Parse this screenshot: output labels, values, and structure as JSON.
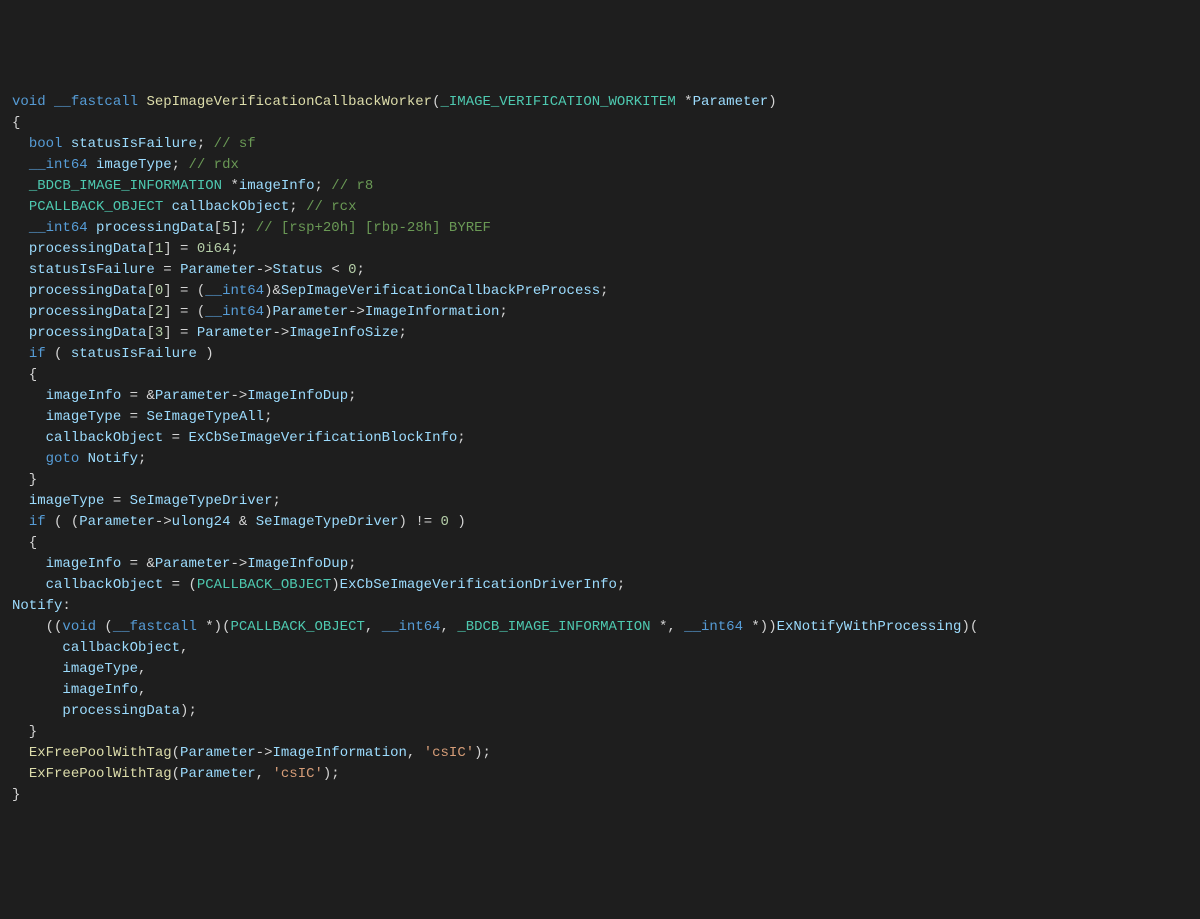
{
  "code": {
    "l01": {
      "t1": "void",
      "t2": "__fastcall",
      "fn": "SepImageVerificationCallbackWorker",
      "op1": "(",
      "type": "_IMAGE_VERIFICATION_WORKITEM",
      "op2": " *",
      "param": "Parameter",
      "op3": ")"
    },
    "l02": "{",
    "l03": {
      "pad": "  ",
      "t1": "bool",
      "v": "statusIsFailure",
      "op": "; ",
      "c": "// sf"
    },
    "l04": {
      "pad": "  ",
      "t1": "__int64",
      "v": "imageType",
      "op": "; ",
      "c": "// rdx"
    },
    "l05": {
      "pad": "  ",
      "t1": "_BDCB_IMAGE_INFORMATION",
      "op1": " *",
      "v": "imageInfo",
      "op2": "; ",
      "c": "// r8"
    },
    "l06": {
      "pad": "  ",
      "t1": "PCALLBACK_OBJECT",
      "v": "callbackObject",
      "op": "; ",
      "c": "// rcx"
    },
    "l07": {
      "pad": "  ",
      "t1": "__int64",
      "v": "processingData",
      "op1": "[",
      "n": "5",
      "op2": "]; ",
      "c": "// [rsp+20h] [rbp-28h] BYREF"
    },
    "l08": "",
    "l09": {
      "pad": "  ",
      "v": "processingData",
      "op1": "[",
      "n1": "1",
      "op2": "] = ",
      "n2": "0i64",
      "op3": ";"
    },
    "l10": {
      "pad": "  ",
      "v1": "statusIsFailure",
      "op1": " = ",
      "v2": "Parameter",
      "op2": "->",
      "m": "Status",
      "op3": " < ",
      "n": "0",
      "op4": ";"
    },
    "l11": {
      "pad": "  ",
      "v": "processingData",
      "op1": "[",
      "n": "0",
      "op2": "] = (",
      "t": "__int64",
      "op3": ")&",
      "g": "SepImageVerificationCallbackPreProcess",
      "op4": ";"
    },
    "l12": {
      "pad": "  ",
      "v": "processingData",
      "op1": "[",
      "n": "2",
      "op2": "] = (",
      "t": "__int64",
      "op3": ")",
      "p": "Parameter",
      "op4": "->",
      "m": "ImageInformation",
      "op5": ";"
    },
    "l13": {
      "pad": "  ",
      "v": "processingData",
      "op1": "[",
      "n": "3",
      "op2": "] = ",
      "p": "Parameter",
      "op3": "->",
      "m": "ImageInfoSize",
      "op4": ";"
    },
    "l14": {
      "pad": "  ",
      "kw": "if",
      "op1": " ( ",
      "v": "statusIsFailure",
      "op2": " )"
    },
    "l15": "  {",
    "l16": {
      "pad": "    ",
      "v": "imageInfo",
      "op1": " = &",
      "p": "Parameter",
      "op2": "->",
      "m": "ImageInfoDup",
      "op3": ";"
    },
    "l17": {
      "pad": "    ",
      "v": "imageType",
      "op1": " = ",
      "g": "SeImageTypeAll",
      "op2": ";"
    },
    "l18": {
      "pad": "    ",
      "v": "callbackObject",
      "op1": " = ",
      "g": "ExCbSeImageVerificationBlockInfo",
      "op2": ";"
    },
    "l19": {
      "pad": "    ",
      "kw": "goto",
      "sp": " ",
      "lbl": "Notify",
      "op": ";"
    },
    "l20": "  }",
    "l21": {
      "pad": "  ",
      "v": "imageType",
      "op1": " = ",
      "g": "SeImageTypeDriver",
      "op2": ";"
    },
    "l22": {
      "pad": "  ",
      "kw": "if",
      "op1": " ( (",
      "p": "Parameter",
      "op2": "->",
      "m": "ulong24",
      "op3": " & ",
      "g": "SeImageTypeDriver",
      "op4": ") != ",
      "n": "0",
      "op5": " )"
    },
    "l23": "  {",
    "l24": {
      "pad": "    ",
      "v": "imageInfo",
      "op1": " = &",
      "p": "Parameter",
      "op2": "->",
      "m": "ImageInfoDup",
      "op3": ";"
    },
    "l25": {
      "pad": "    ",
      "v": "callbackObject",
      "op1": " = (",
      "t": "PCALLBACK_OBJECT",
      "op2": ")",
      "g": "ExCbSeImageVerificationDriverInfo",
      "op3": ";"
    },
    "l26": {
      "lbl": "Notify",
      "op": ":"
    },
    "l27": {
      "pad": "    ((",
      "t1": "void",
      "op1": " (",
      "t2": "__fastcall",
      "op2": " *)(",
      "t3": "PCALLBACK_OBJECT",
      "op3": ", ",
      "t4": "__int64",
      "op4": ", ",
      "t5": "_BDCB_IMAGE_INFORMATION",
      "op5": " *, ",
      "t6": "__int64",
      "op6": " *))",
      "g": "ExNotifyWithProcessing",
      "op7": ")("
    },
    "l28": {
      "pad": "      ",
      "v": "callbackObject",
      "op": ","
    },
    "l29": {
      "pad": "      ",
      "v": "imageType",
      "op": ","
    },
    "l30": {
      "pad": "      ",
      "v": "imageInfo",
      "op": ","
    },
    "l31": {
      "pad": "      ",
      "v": "processingData",
      "op": ");"
    },
    "l32": "  }",
    "l33": {
      "pad": "  ",
      "fn": "ExFreePoolWithTag",
      "op1": "(",
      "p": "Parameter",
      "op2": "->",
      "m": "ImageInformation",
      "op3": ", ",
      "s": "'csIC'",
      "op4": ");"
    },
    "l34": {
      "pad": "  ",
      "fn": "ExFreePoolWithTag",
      "op1": "(",
      "p": "Parameter",
      "op2": ", ",
      "s": "'csIC'",
      "op3": ");"
    },
    "l35": "}"
  }
}
